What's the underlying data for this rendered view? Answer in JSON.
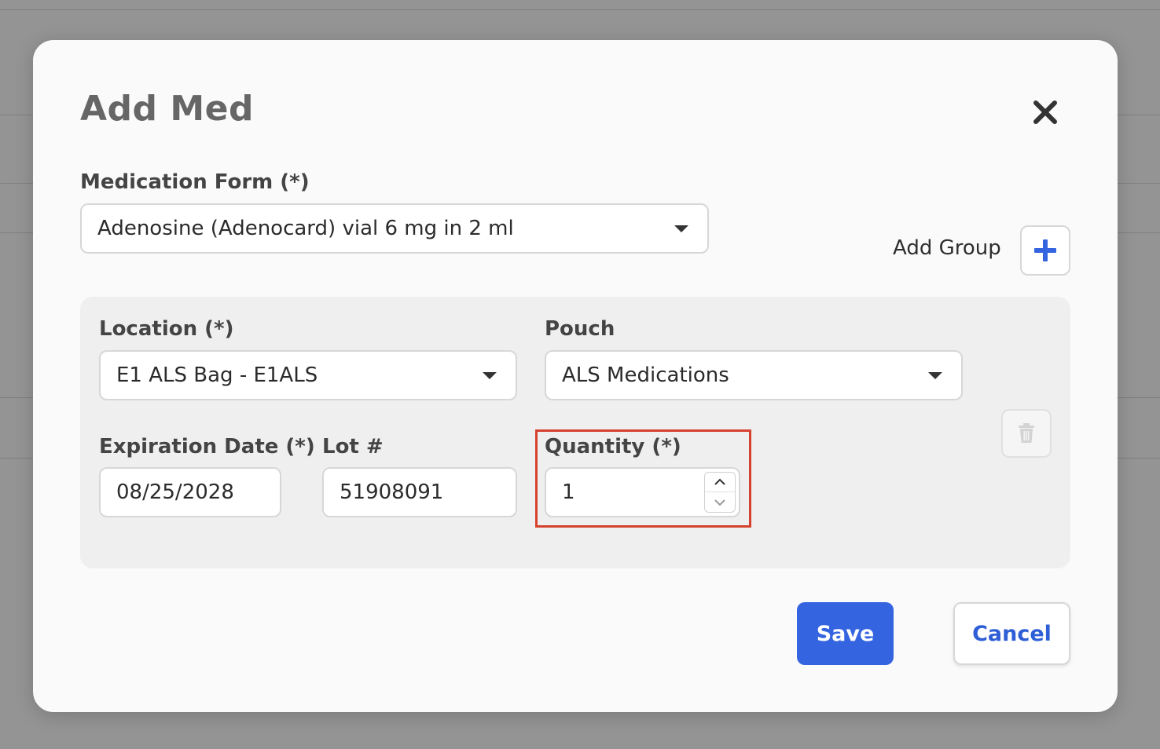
{
  "dialog": {
    "title": "Add Med",
    "close_icon": "close-icon"
  },
  "medication_form": {
    "label": "Medication Form (*)",
    "value": "Adenosine (Adenocard) vial 6 mg in 2 ml"
  },
  "add_group": {
    "label": "Add Group",
    "icon": "plus-icon",
    "accent": "#3464e0"
  },
  "group": {
    "location": {
      "label": "Location (*)",
      "value": "E1 ALS Bag - E1ALS"
    },
    "pouch": {
      "label": "Pouch",
      "value": "ALS Medications"
    },
    "expiration": {
      "label": "Expiration Date (*)",
      "value": "08/25/2028"
    },
    "lot": {
      "label": "Lot #",
      "value": "51908091"
    },
    "quantity": {
      "label": "Quantity (*)",
      "value": "1"
    },
    "delete_icon": "trash-icon"
  },
  "footer": {
    "save_label": "Save",
    "cancel_label": "Cancel"
  },
  "colors": {
    "primary": "#3464e0",
    "highlight": "#d6422f",
    "overlay": "#949494"
  }
}
